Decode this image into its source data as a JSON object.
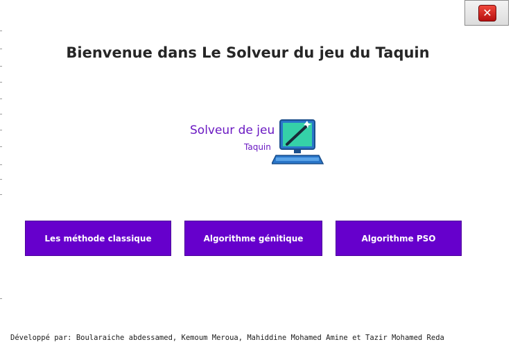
{
  "window": {
    "title": "Bienvenue dans Le Solveur du jeu du Taquin",
    "close_icon": "close-icon"
  },
  "logo": {
    "line1": "Solveur de jeu",
    "line2": "Taquin",
    "icon": "computer-monitor-icon"
  },
  "buttons": [
    {
      "label": "Les méthode classique"
    },
    {
      "label": "Algorithme génitique"
    },
    {
      "label": "Algorithme PSO"
    }
  ],
  "footer": {
    "credits": "Développé par: Boularaiche abdessamed, Kemoum Meroua, Mahiddine Mohamed Amine et Tazir Mohamed Reda"
  },
  "colors": {
    "accent": "#6600cc",
    "logo_text": "#6a18c2",
    "close_red": "#d9261c"
  }
}
